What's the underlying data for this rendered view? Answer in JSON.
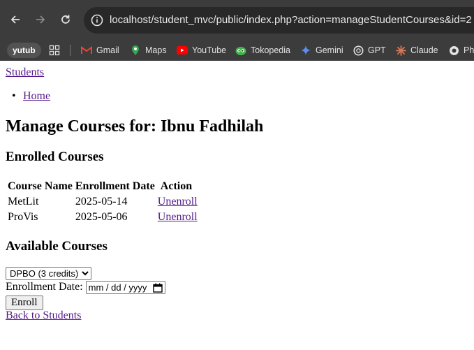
{
  "browser": {
    "url": "localhost/student_mvc/public/index.php?action=manageStudentCourses&id=2",
    "bookmarks": [
      {
        "label": "yutub",
        "icon": "profile-chip"
      },
      {
        "label": "",
        "icon": "apps-grid-icon"
      },
      {
        "label": "Gmail",
        "icon": "gmail-icon"
      },
      {
        "label": "Maps",
        "icon": "maps-icon"
      },
      {
        "label": "YouTube",
        "icon": "youtube-icon"
      },
      {
        "label": "Tokopedia",
        "icon": "tokopedia-icon"
      },
      {
        "label": "Gemini",
        "icon": "gemini-icon"
      },
      {
        "label": "GPT",
        "icon": "openai-icon"
      },
      {
        "label": "Claude",
        "icon": "claude-icon"
      },
      {
        "label": "Pha",
        "icon": "bookmark-icon"
      }
    ]
  },
  "page": {
    "brand_link": "Students",
    "nav": [
      {
        "label": "Home"
      }
    ],
    "title": "Manage Courses for: Ibnu Fadhilah",
    "enrolled": {
      "heading": "Enrolled Courses",
      "columns": [
        "Course Name",
        "Enrollment Date",
        "Action"
      ],
      "rows": [
        {
          "course": "MetLit",
          "date": "2025-05-14",
          "action": "Unenroll"
        },
        {
          "course": "ProVis",
          "date": "2025-05-06",
          "action": "Unenroll"
        }
      ]
    },
    "available": {
      "heading": "Available Courses",
      "selected_course": "DPBO (3 credits)",
      "date_label": "Enrollment Date:",
      "date_placeholder": "mm / dd / yyyy",
      "submit": "Enroll"
    },
    "back_link": "Back to Students"
  }
}
